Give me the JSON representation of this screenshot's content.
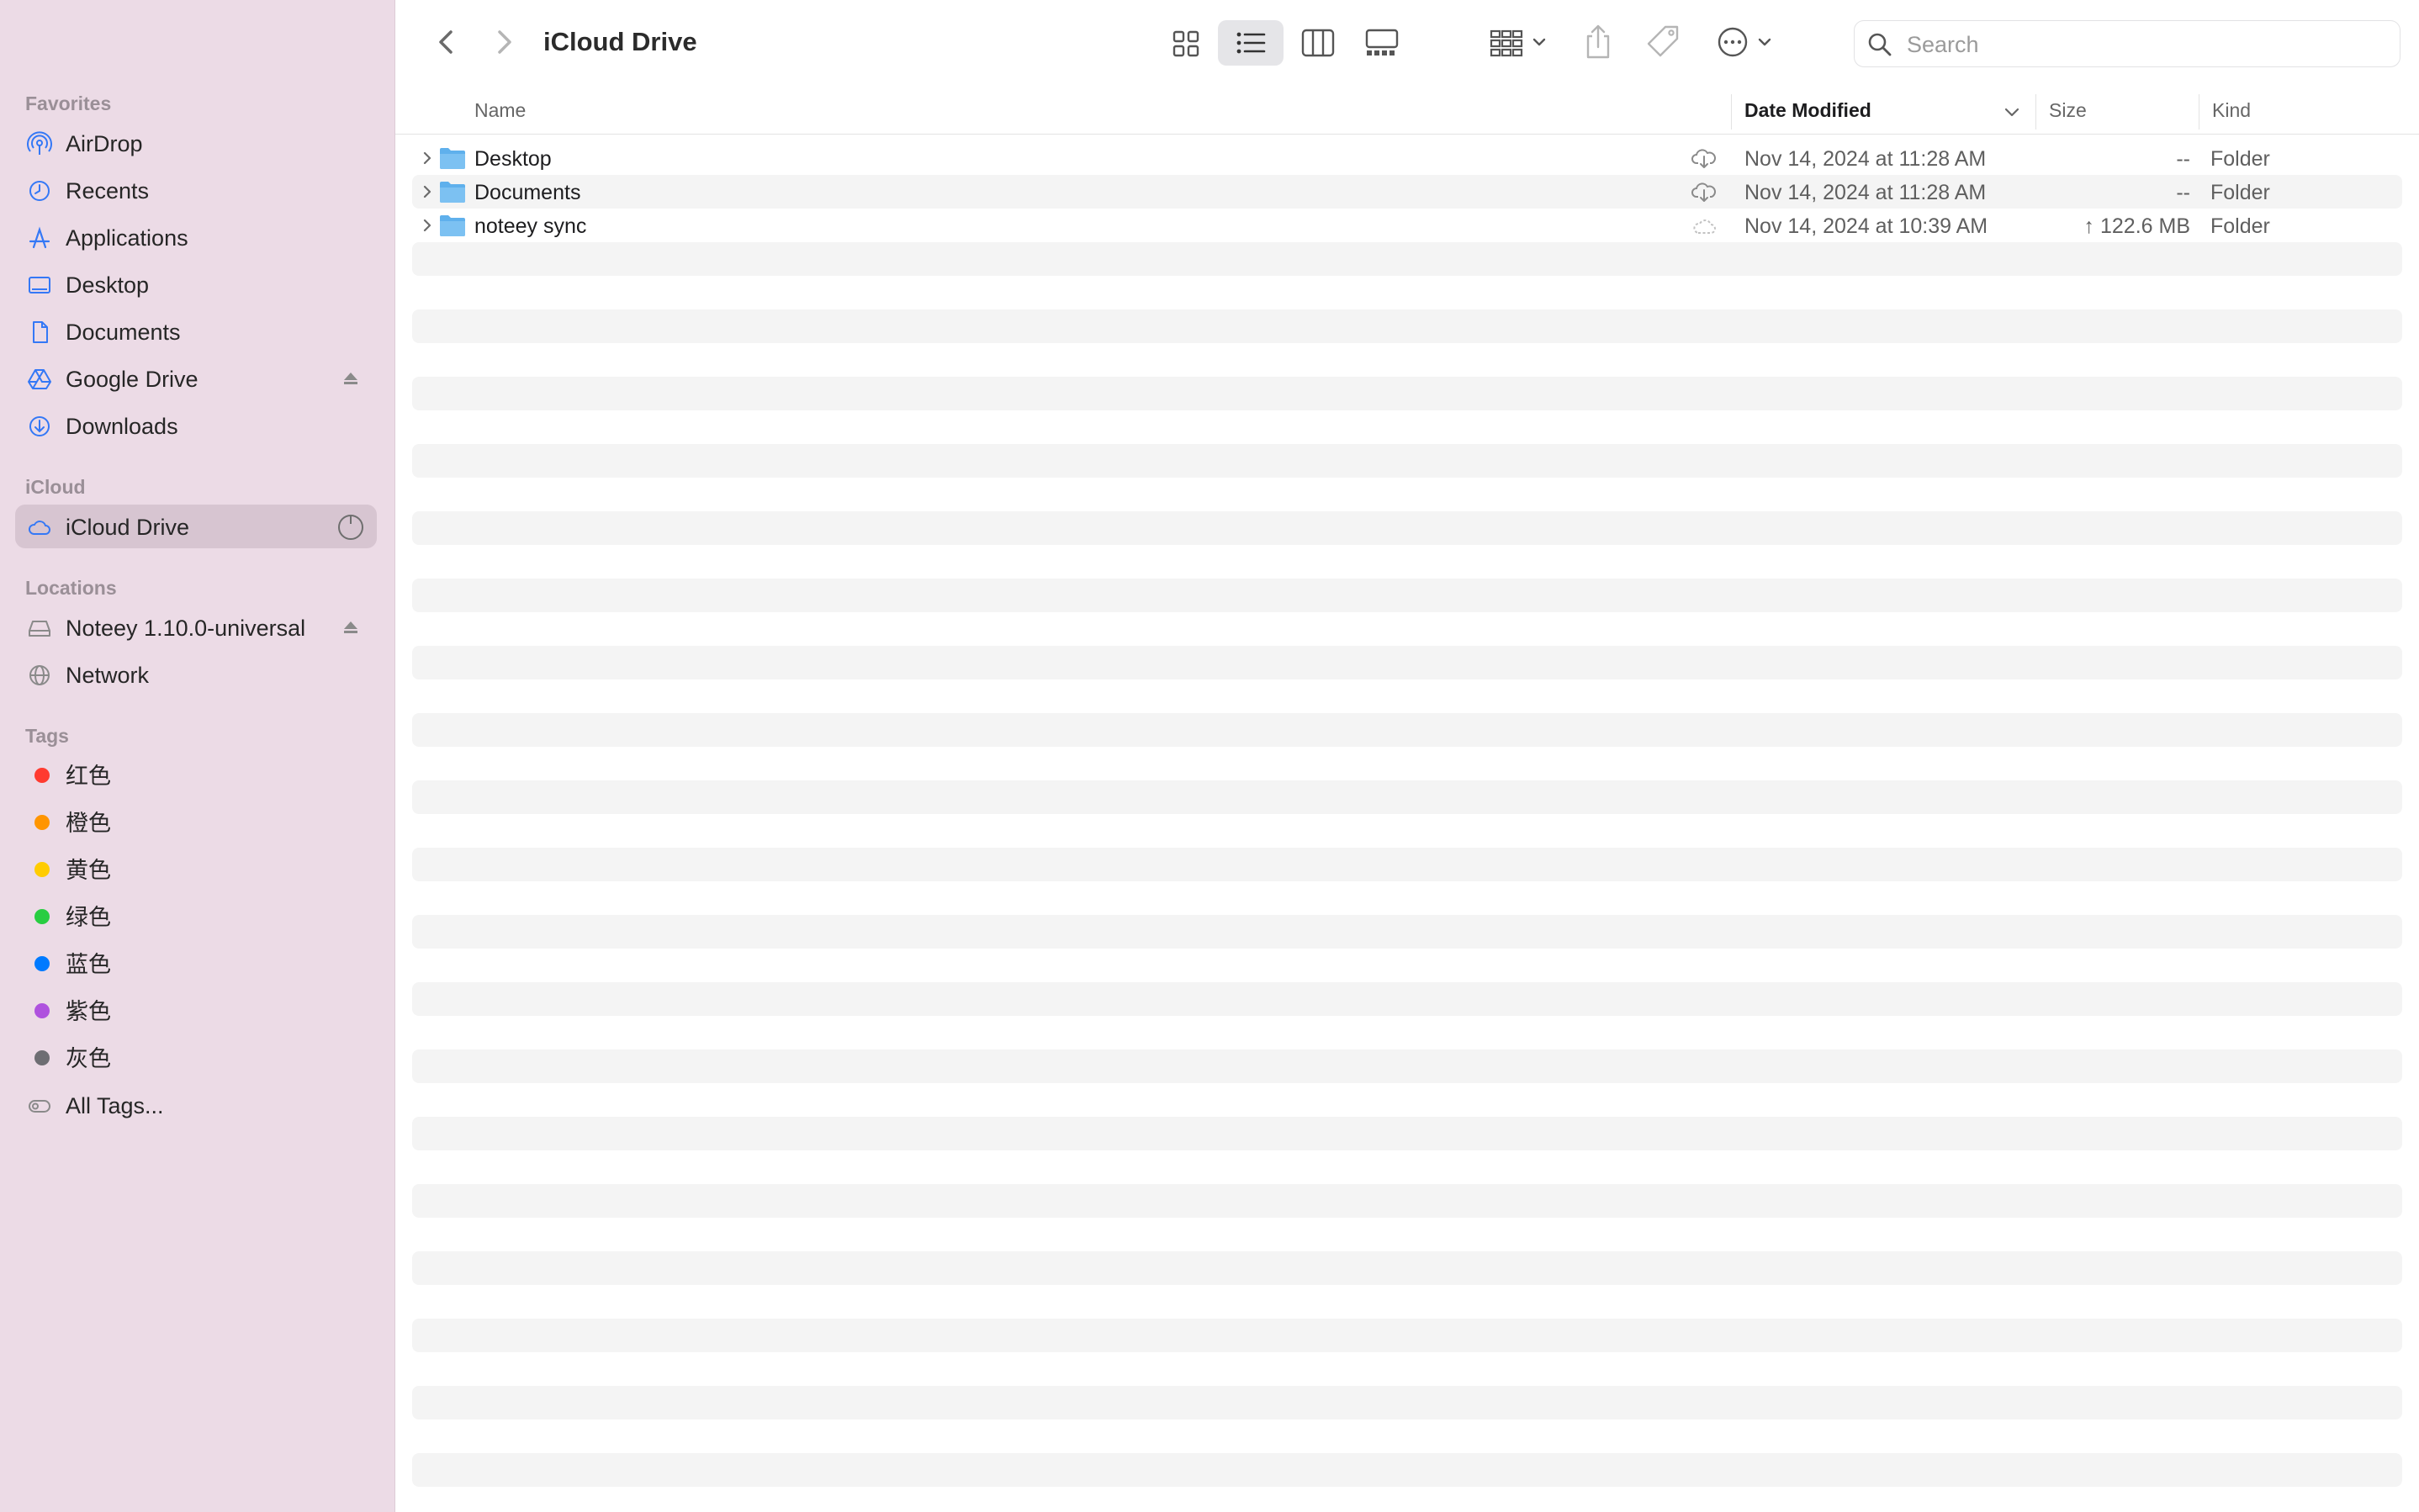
{
  "sidebar": {
    "favorites_header": "Favorites",
    "favorites": [
      {
        "label": "AirDrop",
        "icon": "airdrop-icon"
      },
      {
        "label": "Recents",
        "icon": "clock-icon"
      },
      {
        "label": "Applications",
        "icon": "applications-icon"
      },
      {
        "label": "Desktop",
        "icon": "desktop-icon"
      },
      {
        "label": "Documents",
        "icon": "document-icon"
      },
      {
        "label": "Google Drive",
        "icon": "google-drive-icon"
      },
      {
        "label": "Downloads",
        "icon": "download-icon"
      }
    ],
    "icloud_header": "iCloud",
    "icloud": [
      {
        "label": "iCloud Drive",
        "icon": "cloud-icon",
        "selected": true
      }
    ],
    "locations_header": "Locations",
    "locations": [
      {
        "label": "Noteey 1.10.0-universal",
        "icon": "disk-icon"
      },
      {
        "label": "Network",
        "icon": "globe-icon"
      }
    ],
    "tags_header": "Tags",
    "tags": [
      {
        "label": "红色",
        "color": "#ff3b30"
      },
      {
        "label": "橙色",
        "color": "#ff9500"
      },
      {
        "label": "黄色",
        "color": "#ffcc00"
      },
      {
        "label": "绿色",
        "color": "#28cd41"
      },
      {
        "label": "蓝色",
        "color": "#007aff"
      },
      {
        "label": "紫色",
        "color": "#af52de"
      },
      {
        "label": "灰色",
        "color": "#8e8e93"
      }
    ],
    "all_tags": "All Tags..."
  },
  "toolbar": {
    "title": "iCloud Drive",
    "search_placeholder": "Search"
  },
  "columns": {
    "name": "Name",
    "date_modified": "Date Modified",
    "size": "Size",
    "kind": "Kind"
  },
  "files": [
    {
      "name": "Desktop",
      "date": "Nov 14, 2024 at 11:28 AM",
      "size": "--",
      "kind": "Folder",
      "cloud": "download"
    },
    {
      "name": "Documents",
      "date": "Nov 14, 2024 at 11:28 AM",
      "size": "--",
      "kind": "Folder",
      "cloud": "download"
    },
    {
      "name": "noteey sync",
      "date": "Nov 14, 2024 at 10:39 AM",
      "size": "↑ 122.6 MB",
      "kind": "Folder",
      "cloud": "syncing"
    }
  ],
  "colors": {
    "accent": "#3478f6",
    "sidebar_bg": "#ecdbe6",
    "folder": "#5fb0ec"
  }
}
